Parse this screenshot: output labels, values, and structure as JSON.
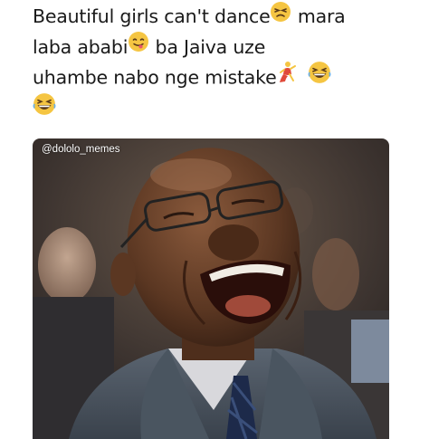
{
  "post": {
    "caption_lines": [
      "Beautiful girls can't dance",
      "mara",
      "laba ababi",
      "ba Jaiva uze",
      "uhambe nabo nge mistake"
    ],
    "emojis": {
      "line1": "persevering-face-icon",
      "line2": "face-savoring-food-icon",
      "line3": [
        "dancing-person-icon",
        "grinning-squinting-face-icon"
      ],
      "line4": "grinning-squinting-face-icon"
    }
  },
  "image": {
    "watermark": "@dololo_memes",
    "description_icon": "laughing-man-photo"
  },
  "colors": {
    "text": "#1a1a1a",
    "emoji_yellow": "#f5c542",
    "suit": "#4a5560",
    "background": "#ffffff"
  }
}
